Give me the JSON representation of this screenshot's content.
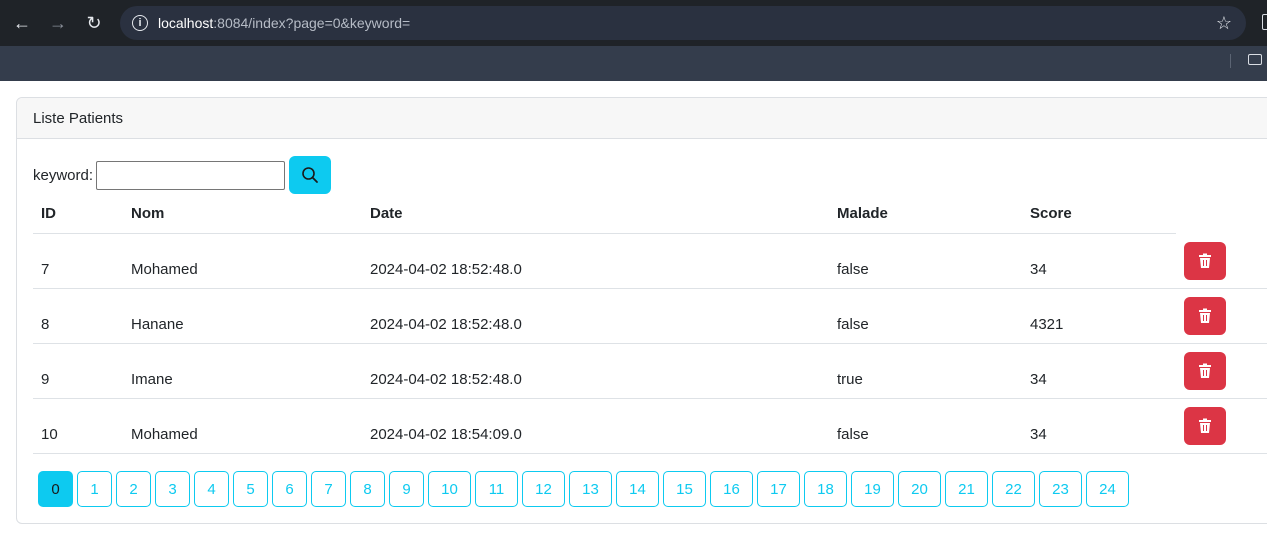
{
  "browser": {
    "url_host": "localhost",
    "url_path": ":8084/index?page=0&keyword=",
    "back_icon": "←",
    "forward_icon": "→",
    "reload_icon": "↻",
    "info_icon": "i",
    "bookmark_icon": "☆"
  },
  "card": {
    "title": "Liste Patients"
  },
  "search": {
    "label": "keyword:",
    "value": ""
  },
  "table": {
    "headers": [
      "ID",
      "Nom",
      "Date",
      "Malade",
      "Score"
    ],
    "rows": [
      [
        "7",
        "Mohamed",
        "2024-04-02 18:52:48.0",
        "false",
        "34"
      ],
      [
        "8",
        "Hanane",
        "2024-04-02 18:52:48.0",
        "false",
        "4321"
      ],
      [
        "9",
        "Imane",
        "2024-04-02 18:52:48.0",
        "true",
        "34"
      ],
      [
        "10",
        "Mohamed",
        "2024-04-02 18:54:09.0",
        "false",
        "34"
      ]
    ]
  },
  "pagination": {
    "pages": [
      "0",
      "1",
      "2",
      "3",
      "4",
      "5",
      "6",
      "7",
      "8",
      "9",
      "10",
      "11",
      "12",
      "13",
      "14",
      "15",
      "16",
      "17",
      "18",
      "19",
      "20",
      "21",
      "22",
      "23",
      "24"
    ],
    "active": "0"
  },
  "colors": {
    "info": "#0dcaf0",
    "danger": "#dc3545"
  }
}
